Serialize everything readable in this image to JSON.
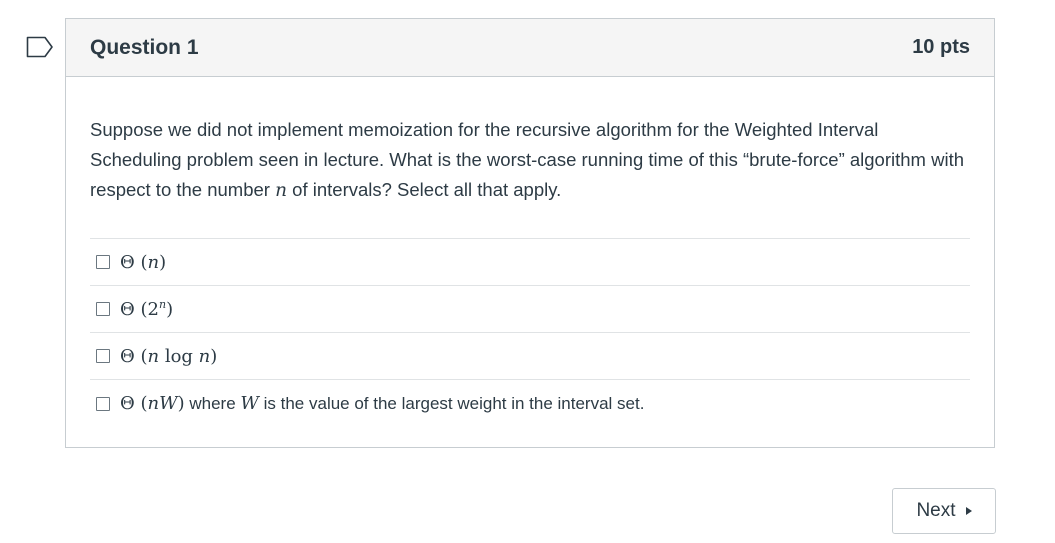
{
  "question": {
    "title": "Question 1",
    "points": "10 pts",
    "text_part1": "Suppose we did not implement memoization for the recursive algorithm for the Weighted Interval Scheduling problem seen in lecture. What is the worst-case running time of this “brute-force” algorithm with respect to the number ",
    "text_var": "n",
    "text_part2": " of intervals? Select all that apply."
  },
  "answers": [
    {
      "theta": "Θ",
      "open": " (",
      "body": "n",
      "close": ")"
    },
    {
      "theta": "Θ",
      "open": " (2",
      "sup": "n",
      "close": ")"
    },
    {
      "theta": "Θ",
      "open": " (",
      "body": "n",
      "mid": " log ",
      "body2": "n",
      "close": ")"
    },
    {
      "theta": "Θ",
      "open": " (",
      "body": "nW",
      "close": ")",
      "tail1": " where ",
      "var": "W",
      "tail2": " is the value of the largest weight in the interval set."
    }
  ],
  "nav": {
    "next_label": "Next"
  },
  "icons": {
    "flag": "flag-outline-icon",
    "next_arrow": "caret-right-icon"
  }
}
